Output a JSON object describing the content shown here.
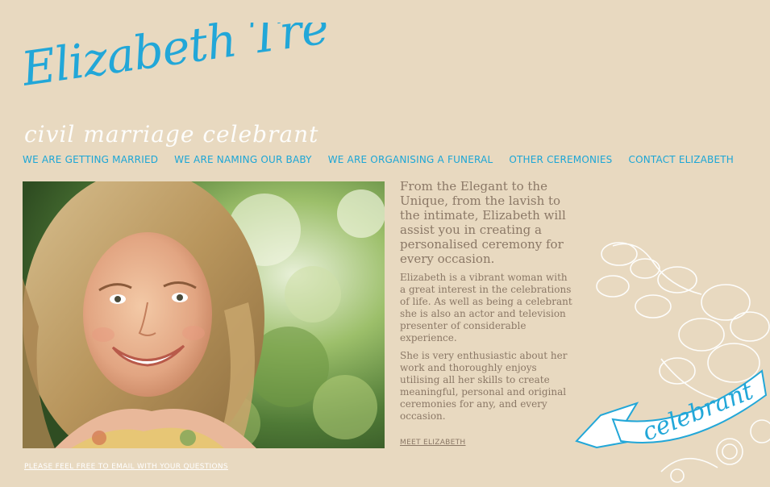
{
  "brand": {
    "name": "Elizabeth Trevan",
    "tagline": "civil marriage celebrant",
    "accent_color": "#22a7d8",
    "background_color": "#e8d9c0"
  },
  "nav": {
    "items": [
      "WE ARE GETTING MARRIED",
      "WE ARE NAMING OUR BABY",
      "WE ARE ORGANISING A FUNERAL",
      "OTHER CEREMONIES",
      "CONTACT ELIZABETH"
    ]
  },
  "main": {
    "intro": "From the Elegant to the Unique, from the lavish to the intimate, Elizabeth will assist you in creating a personalised ceremony for every occasion.",
    "paragraph1": "Elizabeth is a vibrant woman with a great interest in the celebrations of life. As well as being a celebrant she is also an actor and television presenter of considerable experience.",
    "paragraph2": "She is very enthusiastic about her work and thoroughly enjoys utilising all her skills to create meaningful, personal and original ceremonies for any, and every occasion.",
    "meet_link": "MEET ELIZABETH"
  },
  "footer": {
    "email_link": "PLEASE FEEL FREE TO EMAIL WITH YOUR QUESTIONS"
  },
  "decor": {
    "ribbon_text": "celebrant",
    "photo_icon": "portrait-photo"
  }
}
